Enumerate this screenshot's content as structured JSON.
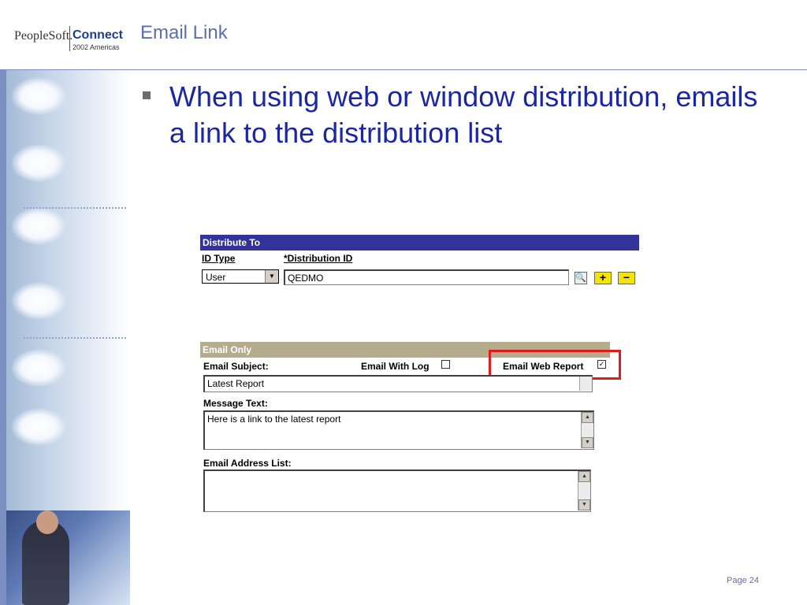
{
  "header": {
    "logo_brand": "PeopleSoft.",
    "logo_product": "Connect",
    "logo_sub": "2002 Americas",
    "slide_title": "Email Link"
  },
  "bullet": {
    "text": "When using web or window distribution, emails a link to the distribution list"
  },
  "distribute_to": {
    "section_title": "Distribute To",
    "id_type_label": "ID Type",
    "id_type_value": "User",
    "distribution_id_label": "*Distribution ID",
    "distribution_id_value": "QEDMO",
    "add_label": "+",
    "delete_label": "−"
  },
  "email_only": {
    "section_title": "Email Only",
    "subject_label": "Email Subject:",
    "subject_value": "Latest Report",
    "with_log_label": "Email With Log",
    "with_log_checked": false,
    "web_report_label": "Email Web Report",
    "web_report_checked": true,
    "message_label": "Message Text:",
    "message_value": "Here is a link to the latest report",
    "address_list_label": "Email Address List:",
    "address_list_value": ""
  },
  "footer": {
    "page_label": "Page 24"
  },
  "colors": {
    "title_color": "#5b6faa",
    "bullet_text_color": "#1b27a0",
    "panel_header_blue": "#33339a",
    "panel_header_tan": "#b5ab8d",
    "highlight_red": "#e11a1a",
    "button_yellow": "#f5e400"
  }
}
